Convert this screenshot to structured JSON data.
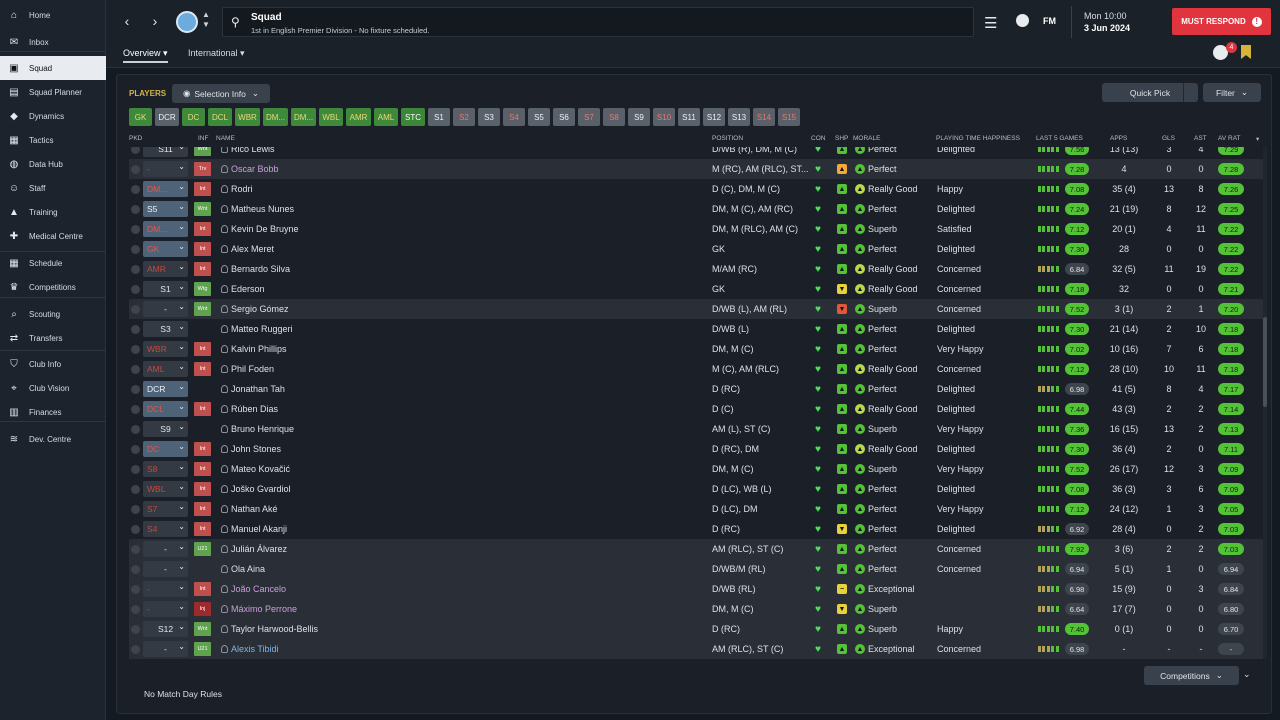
{
  "sidebar": {
    "items": [
      {
        "label": "Home",
        "icon": "home-icon"
      },
      {
        "label": "Inbox",
        "icon": "inbox-icon"
      },
      {
        "label": "Squad",
        "icon": "shirt-icon"
      },
      {
        "label": "Squad Planner",
        "icon": "planner-icon"
      },
      {
        "label": "Dynamics",
        "icon": "dynamics-icon"
      },
      {
        "label": "Tactics",
        "icon": "tactics-icon"
      },
      {
        "label": "Data Hub",
        "icon": "data-hub-icon"
      },
      {
        "label": "Staff",
        "icon": "staff-icon"
      },
      {
        "label": "Training",
        "icon": "training-icon"
      },
      {
        "label": "Medical Centre",
        "icon": "medical-icon"
      },
      {
        "label": "Schedule",
        "icon": "calendar-icon"
      },
      {
        "label": "Competitions",
        "icon": "trophy-icon"
      },
      {
        "label": "Scouting",
        "icon": "scouting-icon"
      },
      {
        "label": "Transfers",
        "icon": "transfers-icon"
      },
      {
        "label": "Club Info",
        "icon": "shield-icon"
      },
      {
        "label": "Club Vision",
        "icon": "vision-icon"
      },
      {
        "label": "Finances",
        "icon": "finances-icon"
      },
      {
        "label": "Dev. Centre",
        "icon": "dev-centre-icon"
      }
    ]
  },
  "header": {
    "title": "Squad",
    "subtitle": "1st in English Premier Division - No fixture scheduled.",
    "fm_logo": "FM",
    "day_time": "Mon 10:00",
    "date": "3 Jun 2024",
    "must_respond": "MUST RESPOND",
    "notification_count": "4",
    "tabs": [
      {
        "label": "Overview ▾"
      },
      {
        "label": "International ▾"
      }
    ]
  },
  "toolbar": {
    "players_label": "PLAYERS",
    "selection_info": "Selection Info",
    "quick_pick": "Quick Pick",
    "filter": "Filter"
  },
  "chips": [
    {
      "label": "GK",
      "style": "g"
    },
    {
      "label": "DCR",
      "style": "s"
    },
    {
      "label": "DC",
      "style": "g"
    },
    {
      "label": "DCL",
      "style": "g"
    },
    {
      "label": "WBR",
      "style": "g"
    },
    {
      "label": "DM...",
      "style": "g"
    },
    {
      "label": "DM...",
      "style": "g"
    },
    {
      "label": "WBL",
      "style": "g"
    },
    {
      "label": "AMR",
      "style": "g"
    },
    {
      "label": "AML",
      "style": "g"
    },
    {
      "label": "STC",
      "style": "gw"
    },
    {
      "label": "S1",
      "style": "s"
    },
    {
      "label": "S2",
      "style": "r"
    },
    {
      "label": "S3",
      "style": "s"
    },
    {
      "label": "S4",
      "style": "r"
    },
    {
      "label": "S5",
      "style": "s"
    },
    {
      "label": "S6",
      "style": "s"
    },
    {
      "label": "S7",
      "style": "r"
    },
    {
      "label": "S8",
      "style": "r"
    },
    {
      "label": "S9",
      "style": "s"
    },
    {
      "label": "S10",
      "style": "r"
    },
    {
      "label": "S11",
      "style": "s"
    },
    {
      "label": "S12",
      "style": "s"
    },
    {
      "label": "S13",
      "style": "s"
    },
    {
      "label": "S14",
      "style": "r"
    },
    {
      "label": "S15",
      "style": "r"
    }
  ],
  "columns": {
    "pkd": "PKD",
    "inf": "INF",
    "name": "NAME",
    "position": "POSITION",
    "con": "CON",
    "shp": "SHP",
    "morale": "MORALE",
    "pth": "PLAYING TIME HAPPINESS",
    "last5": "LAST 5 GAMES",
    "apps": "APPS",
    "gls": "GLS",
    "ast": "AST",
    "avrat": "AV RAT"
  },
  "players": [
    {
      "pkd": "S11",
      "pkdStyle": "dash",
      "inf": "Wnt",
      "infStyle": "grn",
      "name": "Rico Lewis",
      "nameStyle": "",
      "pos": "D/WB (R), DM, M (C)",
      "shp": "up",
      "shpColor": "#54c236",
      "morIcon": "#54c236",
      "morale": "Perfect",
      "pth": "Delighted",
      "l5": "7.56",
      "l5g": true,
      "apps": "13 (13)",
      "gls": "3",
      "ast": "4",
      "avr": "7.29",
      "avg": true
    },
    {
      "pkd": "-",
      "pkdStyle": "dred",
      "inf": "Trv",
      "infStyle": "red",
      "name": "Oscar Bobb",
      "nameStyle": "purple",
      "pos": "M (RC), AM (RLC), ST...",
      "shp": "up",
      "shpColor": "#f2a93a",
      "morIcon": "#54c236",
      "morale": "Perfect",
      "pth": "",
      "l5": "7.28",
      "l5g": true,
      "apps": "4",
      "gls": "0",
      "ast": "0",
      "avr": "7.28",
      "avg": true
    },
    {
      "pkd": "DM...",
      "pkdStyle": "bred",
      "inf": "Int",
      "infStyle": "red",
      "name": "Rodri",
      "nameStyle": "",
      "pos": "D (C), DM, M (C)",
      "shp": "up",
      "shpColor": "#54c236",
      "morIcon": "#b7d94a",
      "morale": "Really Good",
      "pth": "Happy",
      "l5": "7.08",
      "l5g": true,
      "apps": "35 (4)",
      "gls": "13",
      "ast": "8",
      "avr": "7.26",
      "avg": true
    },
    {
      "pkd": "S5",
      "pkdStyle": "blue",
      "inf": "Wnt",
      "infStyle": "grn",
      "name": "Matheus Nunes",
      "nameStyle": "",
      "pos": "DM, M (C), AM (RC)",
      "shp": "up",
      "shpColor": "#54c236",
      "morIcon": "#54c236",
      "morale": "Perfect",
      "pth": "Delighted",
      "l5": "7.24",
      "l5g": true,
      "apps": "21 (19)",
      "gls": "8",
      "ast": "12",
      "avr": "7.25",
      "avg": true
    },
    {
      "pkd": "DM...",
      "pkdStyle": "bred",
      "inf": "Int",
      "infStyle": "red",
      "name": "Kevin De Bruyne",
      "nameStyle": "",
      "pos": "DM, M (RLC), AM (C)",
      "shp": "up",
      "shpColor": "#54c236",
      "morIcon": "#54c236",
      "morale": "Superb",
      "pth": "Satisfied",
      "l5": "7.12",
      "l5g": true,
      "apps": "20 (1)",
      "gls": "4",
      "ast": "11",
      "avr": "7.22",
      "avg": true
    },
    {
      "pkd": "GK",
      "pkdStyle": "bred",
      "inf": "Int",
      "infStyle": "red",
      "name": "Alex Meret",
      "nameStyle": "",
      "pos": "GK",
      "shp": "up",
      "shpColor": "#54c236",
      "morIcon": "#54c236",
      "morale": "Perfect",
      "pth": "Delighted",
      "l5": "7.30",
      "l5g": true,
      "apps": "28",
      "gls": "0",
      "ast": "0",
      "avr": "7.22",
      "avg": true
    },
    {
      "pkd": "AMR",
      "pkdStyle": "dred",
      "inf": "Int",
      "infStyle": "red",
      "name": "Bernardo Silva",
      "nameStyle": "",
      "pos": "M/AM (RC)",
      "shp": "up",
      "shpColor": "#54c236",
      "morIcon": "#b7d94a",
      "morale": "Really Good",
      "pth": "Concerned",
      "l5": "6.84",
      "l5g": false,
      "apps": "32 (5)",
      "gls": "11",
      "ast": "19",
      "avr": "7.22",
      "avg": true
    },
    {
      "pkd": "S1",
      "pkdStyle": "dash",
      "inf": "Wtg",
      "infStyle": "grn",
      "name": "Ederson",
      "nameStyle": "",
      "pos": "GK",
      "shp": "down",
      "shpColor": "#e8d23a",
      "morIcon": "#b7d94a",
      "morale": "Really Good",
      "pth": "Concerned",
      "l5": "7.18",
      "l5g": true,
      "apps": "32",
      "gls": "0",
      "ast": "0",
      "avr": "7.21",
      "avg": true
    },
    {
      "pkd": "-",
      "pkdStyle": "dash",
      "inf": "Wnt",
      "infStyle": "grn",
      "name": "Sergio Gómez",
      "nameStyle": "",
      "pos": "D/WB (L), AM (RL)",
      "shp": "down",
      "shpColor": "#e0573c",
      "morIcon": "#54c236",
      "morale": "Superb",
      "pth": "Concerned",
      "l5": "7.52",
      "l5g": true,
      "apps": "3 (1)",
      "gls": "2",
      "ast": "1",
      "avr": "7.20",
      "avg": true
    },
    {
      "pkd": "S3",
      "pkdStyle": "dash",
      "inf": "",
      "infStyle": "",
      "name": "Matteo Ruggeri",
      "nameStyle": "",
      "pos": "D/WB (L)",
      "shp": "up",
      "shpColor": "#54c236",
      "morIcon": "#54c236",
      "morale": "Perfect",
      "pth": "Delighted",
      "l5": "7.30",
      "l5g": true,
      "apps": "21 (14)",
      "gls": "2",
      "ast": "10",
      "avr": "7.18",
      "avg": true
    },
    {
      "pkd": "WBR",
      "pkdStyle": "dred",
      "inf": "Int",
      "infStyle": "red",
      "name": "Kalvin Phillips",
      "nameStyle": "",
      "pos": "DM, M (C)",
      "shp": "up",
      "shpColor": "#54c236",
      "morIcon": "#54c236",
      "morale": "Perfect",
      "pth": "Very Happy",
      "l5": "7.02",
      "l5g": true,
      "apps": "10 (16)",
      "gls": "7",
      "ast": "6",
      "avr": "7.18",
      "avg": true
    },
    {
      "pkd": "AML",
      "pkdStyle": "dred",
      "inf": "Int",
      "infStyle": "red",
      "name": "Phil Foden",
      "nameStyle": "",
      "pos": "M (C), AM (RLC)",
      "shp": "up",
      "shpColor": "#54c236",
      "morIcon": "#b7d94a",
      "morale": "Really Good",
      "pth": "Concerned",
      "l5": "7.12",
      "l5g": true,
      "apps": "28 (10)",
      "gls": "10",
      "ast": "11",
      "avr": "7.18",
      "avg": true
    },
    {
      "pkd": "DCR",
      "pkdStyle": "blue",
      "inf": "",
      "infStyle": "",
      "name": "Jonathan Tah",
      "nameStyle": "",
      "pos": "D (RC)",
      "shp": "up",
      "shpColor": "#54c236",
      "morIcon": "#54c236",
      "morale": "Perfect",
      "pth": "Delighted",
      "l5": "6.98",
      "l5g": false,
      "apps": "41 (5)",
      "gls": "8",
      "ast": "4",
      "avr": "7.17",
      "avg": true
    },
    {
      "pkd": "DCL",
      "pkdStyle": "bred",
      "inf": "Int",
      "infStyle": "red",
      "name": "Rúben Dias",
      "nameStyle": "",
      "pos": "D (C)",
      "shp": "up",
      "shpColor": "#54c236",
      "morIcon": "#b7d94a",
      "morale": "Really Good",
      "pth": "Delighted",
      "l5": "7.44",
      "l5g": true,
      "apps": "43 (3)",
      "gls": "2",
      "ast": "2",
      "avr": "7.14",
      "avg": true
    },
    {
      "pkd": "S9",
      "pkdStyle": "dash",
      "inf": "",
      "infStyle": "",
      "name": "Bruno Henrique",
      "nameStyle": "",
      "pos": "AM (L), ST (C)",
      "shp": "up",
      "shpColor": "#54c236",
      "morIcon": "#54c236",
      "morale": "Superb",
      "pth": "Very Happy",
      "l5": "7.36",
      "l5g": true,
      "apps": "16 (15)",
      "gls": "13",
      "ast": "2",
      "avr": "7.13",
      "avg": true
    },
    {
      "pkd": "DC",
      "pkdStyle": "bred",
      "inf": "Int",
      "infStyle": "red",
      "name": "John Stones",
      "nameStyle": "",
      "pos": "D (RC), DM",
      "shp": "up",
      "shpColor": "#54c236",
      "morIcon": "#b7d94a",
      "morale": "Really Good",
      "pth": "Delighted",
      "l5": "7.30",
      "l5g": true,
      "apps": "36 (4)",
      "gls": "2",
      "ast": "0",
      "avr": "7.11",
      "avg": true
    },
    {
      "pkd": "S8",
      "pkdStyle": "dred",
      "inf": "Int",
      "infStyle": "red",
      "name": "Mateo Kovačić",
      "nameStyle": "",
      "pos": "DM, M (C)",
      "shp": "up",
      "shpColor": "#54c236",
      "morIcon": "#54c236",
      "morale": "Superb",
      "pth": "Very Happy",
      "l5": "7.52",
      "l5g": true,
      "apps": "26 (17)",
      "gls": "12",
      "ast": "3",
      "avr": "7.09",
      "avg": true
    },
    {
      "pkd": "WBL",
      "pkdStyle": "dred",
      "inf": "Int",
      "infStyle": "red",
      "name": "Joško Gvardiol",
      "nameStyle": "",
      "pos": "D (LC), WB (L)",
      "shp": "up",
      "shpColor": "#54c236",
      "morIcon": "#54c236",
      "morale": "Perfect",
      "pth": "Delighted",
      "l5": "7.08",
      "l5g": true,
      "apps": "36 (3)",
      "gls": "3",
      "ast": "6",
      "avr": "7.09",
      "avg": true
    },
    {
      "pkd": "S7",
      "pkdStyle": "dred",
      "inf": "Int",
      "infStyle": "red",
      "name": "Nathan Aké",
      "nameStyle": "",
      "pos": "D (LC), DM",
      "shp": "up",
      "shpColor": "#54c236",
      "morIcon": "#54c236",
      "morale": "Perfect",
      "pth": "Very Happy",
      "l5": "7.12",
      "l5g": true,
      "apps": "24 (12)",
      "gls": "1",
      "ast": "3",
      "avr": "7.05",
      "avg": true
    },
    {
      "pkd": "S4",
      "pkdStyle": "dred",
      "inf": "Int",
      "infStyle": "red",
      "name": "Manuel Akanji",
      "nameStyle": "",
      "pos": "D (RC)",
      "shp": "down",
      "shpColor": "#e8d23a",
      "morIcon": "#54c236",
      "morale": "Perfect",
      "pth": "Delighted",
      "l5": "6.92",
      "l5g": false,
      "apps": "28 (4)",
      "gls": "0",
      "ast": "2",
      "avr": "7.03",
      "avg": true
    },
    {
      "pkd": "-",
      "pkdStyle": "dash",
      "inf": "U21",
      "infStyle": "grn",
      "name": "Julián Álvarez",
      "nameStyle": "",
      "pos": "AM (RLC), ST (C)",
      "shp": "up",
      "shpColor": "#54c236",
      "morIcon": "#54c236",
      "morale": "Perfect",
      "pth": "Concerned",
      "l5": "7.92",
      "l5g": true,
      "apps": "3 (6)",
      "gls": "2",
      "ast": "2",
      "avr": "7.03",
      "avg": true
    },
    {
      "pkd": "-",
      "pkdStyle": "dash",
      "inf": "",
      "infStyle": "",
      "name": "Ola Aina",
      "nameStyle": "",
      "pos": "D/WB/M (RL)",
      "shp": "up",
      "shpColor": "#54c236",
      "morIcon": "#54c236",
      "morale": "Perfect",
      "pth": "Concerned",
      "l5": "6.94",
      "l5g": false,
      "apps": "5 (1)",
      "gls": "1",
      "ast": "0",
      "avr": "6.94",
      "avg": false
    },
    {
      "pkd": "-",
      "pkdStyle": "dred",
      "inf": "Int",
      "infStyle": "red",
      "name": "João Cancelo",
      "nameStyle": "purple",
      "pos": "D/WB (RL)",
      "shp": "flat",
      "shpColor": "#e8d23a",
      "morIcon": "#54c236",
      "morale": "Exceptional",
      "pth": "",
      "l5": "6.98",
      "l5g": false,
      "apps": "15 (9)",
      "gls": "0",
      "ast": "3",
      "avr": "6.84",
      "avg": false
    },
    {
      "pkd": "-",
      "pkdStyle": "dred",
      "inf": "Inj",
      "infStyle": "dred",
      "name": "Máximo Perrone",
      "nameStyle": "purple",
      "pos": "DM, M (C)",
      "shp": "down",
      "shpColor": "#e8d23a",
      "morIcon": "#54c236",
      "morale": "Superb",
      "pth": "",
      "l5": "6.64",
      "l5g": false,
      "apps": "17 (7)",
      "gls": "0",
      "ast": "0",
      "avr": "6.80",
      "avg": false
    },
    {
      "pkd": "S12",
      "pkdStyle": "dash",
      "inf": "Wnt",
      "infStyle": "grn",
      "name": "Taylor Harwood-Bellis",
      "nameStyle": "",
      "pos": "D (RC)",
      "shp": "up",
      "shpColor": "#54c236",
      "morIcon": "#54c236",
      "morale": "Superb",
      "pth": "Happy",
      "l5": "7.40",
      "l5g": true,
      "apps": "0 (1)",
      "gls": "0",
      "ast": "0",
      "avr": "6.70",
      "avg": false
    },
    {
      "pkd": "-",
      "pkdStyle": "dash",
      "inf": "U21",
      "infStyle": "grn",
      "name": "Alexis Tibidi",
      "nameStyle": "blue",
      "pos": "AM (RLC), ST (C)",
      "shp": "up",
      "shpColor": "#54c236",
      "morIcon": "#54c236",
      "morale": "Exceptional",
      "pth": "Concerned",
      "l5": "6.98",
      "l5g": false,
      "apps": "-",
      "gls": "-",
      "ast": "-",
      "avr": "-",
      "avg": false
    }
  ],
  "footer": {
    "no_rules": "No Match Day Rules",
    "competitions": "Competitions"
  }
}
